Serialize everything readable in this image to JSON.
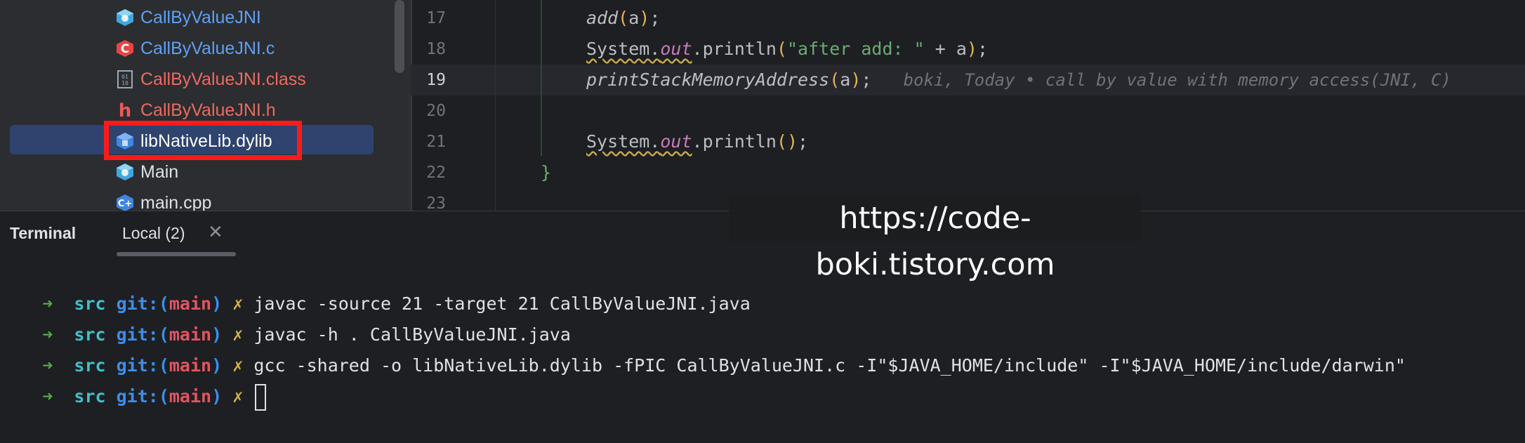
{
  "file_tree": {
    "items": [
      {
        "label": "CallByValueJNI",
        "icon": "java-class-icon",
        "color": "#5fa0f4"
      },
      {
        "label": "CallByValueJNI.c",
        "icon": "c-file-icon",
        "color": "#5fa0f4"
      },
      {
        "label": "CallByValueJNI.class",
        "icon": "binary-class-file-icon",
        "color": "#ec6a60"
      },
      {
        "label": "CallByValueJNI.h",
        "icon": "h-header-file-icon",
        "color": "#ec6a60"
      },
      {
        "label": "libNativeLib.dylib",
        "icon": "library-file-icon",
        "color": "#ffffff",
        "selected": true
      },
      {
        "label": "Main",
        "icon": "java-class-icon",
        "color": "#dfe1e5"
      },
      {
        "label": "main.cpp",
        "icon": "cpp-file-icon",
        "color": "#dfe1e5"
      }
    ],
    "highlight_color": "#ff1a1a"
  },
  "editor": {
    "lines": [
      {
        "num": "17",
        "text": "add(a);"
      },
      {
        "num": "18",
        "text": "System.out.println(\"after add: \" + a);"
      },
      {
        "num": "19",
        "text": "printStackMemoryAddress(a);",
        "active": true
      },
      {
        "num": "20",
        "text": ""
      },
      {
        "num": "21",
        "text": "System.out.println();"
      },
      {
        "num": "22",
        "text": "}"
      },
      {
        "num": "23",
        "text": ""
      }
    ],
    "blame_hint": "boki, Today • call by value with memory access(JNI, C)"
  },
  "watermark": "https://code-boki.tistory.com",
  "terminal": {
    "title": "Terminal",
    "tab_label": "Local (2)",
    "prompt": {
      "arrow": "➜",
      "dir": "src",
      "git_prefix": "git:(",
      "branch": "main",
      "git_suffix": ")",
      "dirty": "✗"
    },
    "commands": [
      "javac -source 21 -target 21 CallByValueJNI.java",
      "javac -h . CallByValueJNI.java",
      "gcc -shared -o libNativeLib.dylib -fPIC CallByValueJNI.c -I\"$JAVA_HOME/include\" -I\"$JAVA_HOME/include/darwin\"",
      ""
    ]
  }
}
